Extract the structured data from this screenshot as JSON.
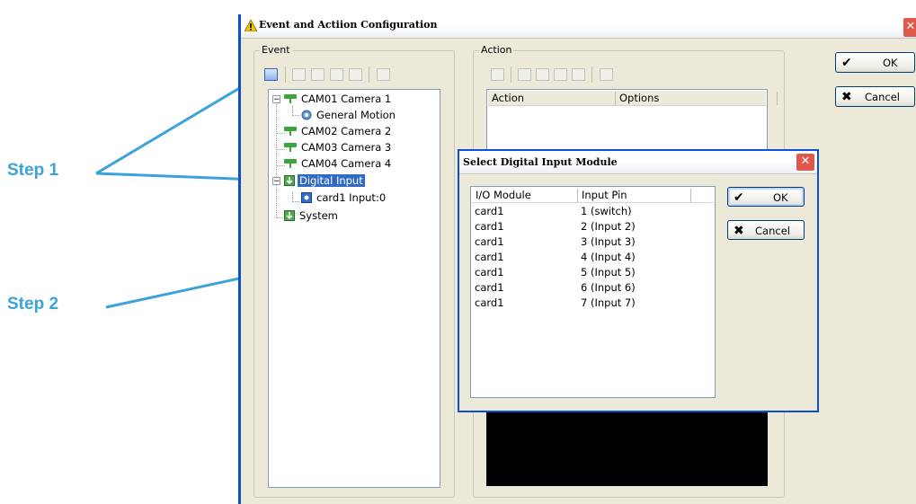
{
  "annotations": {
    "step1": "Step 1",
    "step2": "Step 2"
  },
  "window": {
    "title": "Event and Actiion Configuration",
    "close": "✕",
    "ok_label": "OK",
    "cancel_label": "Cancel"
  },
  "event_group": {
    "label": "Event",
    "tree": {
      "cam1": "CAM01 Camera 1",
      "motion": "General Motion",
      "cam2": "CAM02 Camera 2",
      "cam3": "CAM03 Camera 3",
      "cam4": "CAM04 Camera 4",
      "digital_input": "Digital Input",
      "card_input": "card1 Input:0",
      "system": "System"
    }
  },
  "action_group": {
    "label": "Action",
    "columns": [
      "Action",
      "Options"
    ]
  },
  "dialog": {
    "title": "Select Digital Input Module",
    "close": "✕",
    "columns": [
      "I/O Module",
      "Input Pin"
    ],
    "rows": [
      {
        "module": "card1",
        "pin": "1 (switch)"
      },
      {
        "module": "card1",
        "pin": "2 (Input 2)"
      },
      {
        "module": "card1",
        "pin": "3 (Input 3)"
      },
      {
        "module": "card1",
        "pin": "4 (Input 4)"
      },
      {
        "module": "card1",
        "pin": "5 (Input 5)"
      },
      {
        "module": "card1",
        "pin": "6 (Input 6)"
      },
      {
        "module": "card1",
        "pin": "7 (Input 7)"
      }
    ],
    "ok_label": "OK",
    "cancel_label": "Cancel"
  },
  "colors": {
    "annotation": "#3ba2dc",
    "xp_title_blue": "#0a4fd4",
    "selection": "#316ac5",
    "close_red": "#e2574c"
  }
}
